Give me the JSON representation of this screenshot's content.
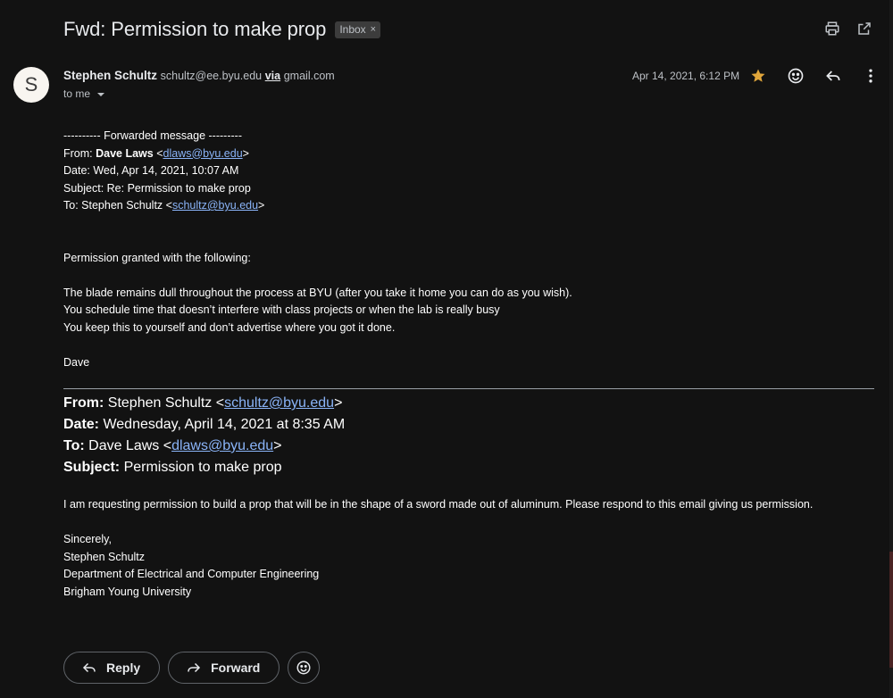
{
  "header": {
    "subject": "Fwd: Permission to make prop",
    "label": "Inbox",
    "label_remove": "×",
    "icons": [
      "print-icon",
      "open-in-new-window-icon"
    ]
  },
  "sender": {
    "avatar_letter": "S",
    "name": "Stephen Schultz",
    "email": "schultz@ee.byu.edu",
    "via": "via",
    "via_domain": "gmail.com",
    "to": "to me",
    "date": "Apr 14, 2021, 6:12 PM",
    "icons": [
      "star-icon",
      "emoji-reaction-icon",
      "reply-icon",
      "more-vert-icon"
    ],
    "star_color": "#e0a63b"
  },
  "forwarded": {
    "separator": "---------- Forwarded message ---------",
    "from_label": "From: ",
    "from_name": "Dave Laws",
    "from_email": "dlaws@byu.edu",
    "date_line": "Date: Wed, Apr 14, 2021, 10:07 AM",
    "subject_line": "Subject: Re: Permission to make prop",
    "to_label": "To: Stephen Schultz <",
    "to_email": "schultz@byu.edu",
    "to_close": ">",
    "paragraphs": [
      "Permission granted with the following:",
      "The blade remains dull throughout the process at BYU (after you take it home you can do as you wish).",
      "You schedule time that doesn’t interfere with class projects or when the lab is really busy",
      "You keep this to yourself and don’t advertise where you got it done.",
      "Dave"
    ]
  },
  "quoted": {
    "from_label": "From:",
    "from_text": " Stephen Schultz <",
    "from_email": "schultz@byu.edu",
    "from_close": ">",
    "date_label": "Date:",
    "date_text": " Wednesday, April 14, 2021 at 8:35 AM",
    "to_label": "To:",
    "to_text": " Dave Laws <",
    "to_email": "dlaws@byu.edu",
    "to_close": ">",
    "subject_label": "Subject:",
    "subject_text": " Permission to make prop",
    "request": "I am requesting permission to build a prop that will be in the shape of a sword made out of aluminum.  Please respond to this email giving us permission.",
    "signature": [
      "Sincerely,",
      "Stephen Schultz",
      "Department of Electrical and Computer Engineering",
      "Brigham Young University"
    ]
  },
  "actions": {
    "reply": "Reply",
    "forward": "Forward",
    "icons": [
      "reply-icon",
      "forward-icon",
      "emoji-reaction-icon"
    ]
  },
  "colors": {
    "background": "#121212",
    "link": "#8ab4f8"
  }
}
